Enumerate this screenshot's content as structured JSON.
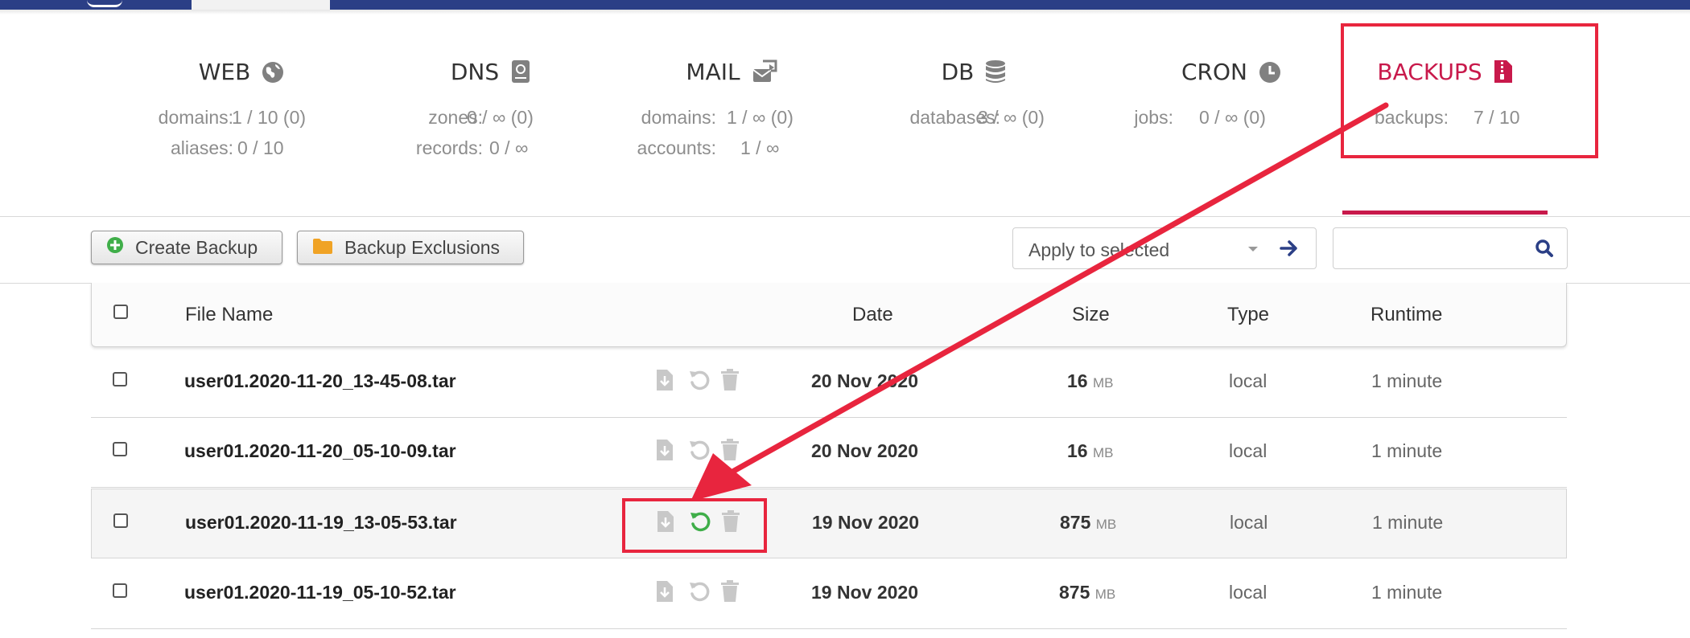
{
  "stats": [
    {
      "title": "WEB",
      "icon": "globe-icon",
      "rows": [
        {
          "label": "domains:",
          "value": "1 / 10 (0)"
        },
        {
          "label": "aliases:",
          "value": "0 / 10"
        }
      ]
    },
    {
      "title": "DNS",
      "icon": "address-book-icon",
      "rows": [
        {
          "label": "zones:",
          "value": "0 / ∞ (0)"
        },
        {
          "label": "records:",
          "value": "0 / ∞"
        }
      ]
    },
    {
      "title": "MAIL",
      "icon": "mail-forward-icon",
      "rows": [
        {
          "label": "domains:",
          "value": "1 / ∞ (0)"
        },
        {
          "label": "accounts:",
          "value": "1 / ∞"
        }
      ]
    },
    {
      "title": "DB",
      "icon": "database-icon",
      "rows": [
        {
          "label": "databases:",
          "value": "3 / ∞ (0)"
        }
      ]
    },
    {
      "title": "CRON",
      "icon": "clock-icon",
      "rows": [
        {
          "label": "jobs:",
          "value": "0 / ∞ (0)"
        }
      ]
    },
    {
      "title": "BACKUPS",
      "icon": "file-archive-icon",
      "rows": [
        {
          "label": "backups:",
          "value": "7 / 10"
        }
      ]
    }
  ],
  "toolbar": {
    "create_label": "Create Backup",
    "exclusions_label": "Backup Exclusions",
    "select_value": "Apply to selected",
    "search_value": ""
  },
  "table": {
    "headers": {
      "file_name": "File Name",
      "date": "Date",
      "size": "Size",
      "type": "Type",
      "runtime": "Runtime"
    },
    "rows": [
      {
        "file": "user01.2020-11-20_13-45-08.tar",
        "date": "20  Nov  2020",
        "size": "16",
        "unit": "MB",
        "type": "local",
        "runtime": "1 minute"
      },
      {
        "file": "user01.2020-11-20_05-10-09.tar",
        "date": "20  Nov  2020",
        "size": "16",
        "unit": "MB",
        "type": "local",
        "runtime": "1 minute"
      },
      {
        "file": "user01.2020-11-19_13-05-53.tar",
        "date": "19  Nov  2020",
        "size": "875",
        "unit": "MB",
        "type": "local",
        "runtime": "1 minute"
      },
      {
        "file": "user01.2020-11-19_05-10-52.tar",
        "date": "19  Nov  2020",
        "size": "875",
        "unit": "MB",
        "type": "local",
        "runtime": "1 minute"
      }
    ]
  },
  "colors": {
    "brand": "#2b3f86",
    "accent": "#c8194b",
    "annotation": "#e8253e",
    "restore_active": "#3fae49"
  }
}
